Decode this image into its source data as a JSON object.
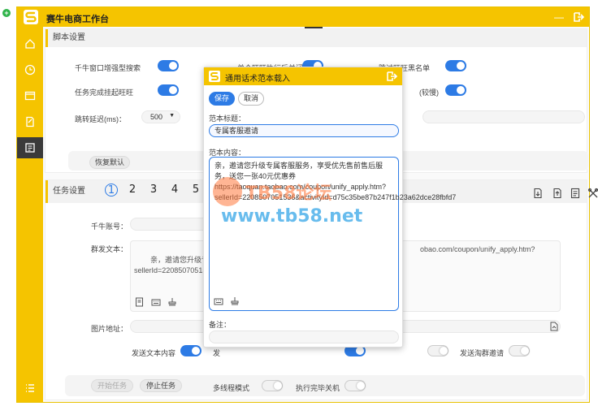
{
  "app": {
    "title": "赛牛电商工作台"
  },
  "script_section": {
    "title": "脚本设置",
    "toggles": [
      {
        "label": "千牛窗口增强型搜索",
        "on": true
      },
      {
        "label": "单个旺旺执行后关闭",
        "on": true
      },
      {
        "label": "跳过旺旺黑名单",
        "on": true
      },
      {
        "label": "任务完成挂起旺旺",
        "on": true
      },
      {
        "label": "(较慢)",
        "on": true
      }
    ],
    "delay_label": "跳转延迟(ms)：",
    "delay_value": "500",
    "restore_button": "恢复默认"
  },
  "task_section": {
    "title": "任务设置",
    "tabs": [
      "1",
      "2",
      "3",
      "4",
      "5"
    ],
    "qianniu_label": "千牛账号：",
    "group_text_label": "群发文本：",
    "group_text_preview": "亲，邀请您升级专属客服服务\nsellerId=2208507051536&a",
    "group_text_right": "obao.com/coupon/unify_apply.htm?",
    "image_label": "图片地址：",
    "options": [
      {
        "label": "发送文本内容",
        "on": true
      },
      {
        "label": "发",
        "on": true
      },
      {
        "label": "",
        "on": false
      },
      {
        "label": "发送淘群邀请",
        "on": false
      }
    ],
    "start_button": "开始任务",
    "stop_button": "停止任务",
    "multithread_label": "多线程模式",
    "shutdown_label": "执行完毕关机"
  },
  "dialog": {
    "title": "通用话术范本载入",
    "save_button": "保存",
    "cancel_button": "取消",
    "template_title_label": "范本标题：",
    "template_title_value": "专属客服邀请",
    "template_content_label": "范本内容：",
    "template_content_value": "亲，邀请您升级专属客服服务，享受优先售前售后服务，送您一张40元优惠券\nhttps://taoquan.taobao.com/coupon/unify_apply.htm?sellerId=2208507051536&activityId=d75c35be87b247f1b23a62dce28fbfd7",
    "remark_label": "备注："
  },
  "watermark": {
    "line1": "TB58论坛",
    "line2": "www.tb58.net"
  },
  "colors": {
    "brand": "#f5c400",
    "accent": "#2d7be5",
    "sidebar_active": "#3a3a3a"
  }
}
